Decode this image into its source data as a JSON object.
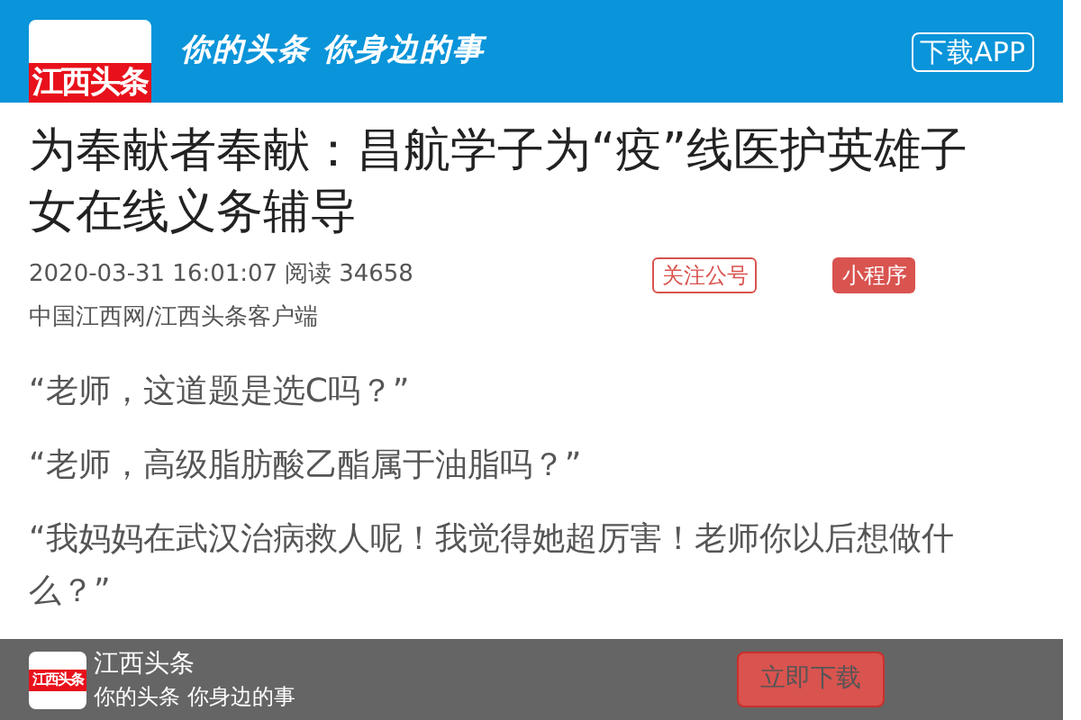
{
  "header": {
    "logo_text": "江西头条",
    "slogan": "你的头条 你身边的事",
    "download_button": "下载APP"
  },
  "article": {
    "title": "为奉献者奉献：昌航学子为“疫”线医护英雄子女在线义务辅导",
    "datetime": "2020-03-31 16:01:07",
    "read_label": "阅读",
    "read_count": "34658",
    "follow_button": "关注公号",
    "miniprogram_button": "小程序",
    "source": "中国江西网/江西头条客户端",
    "paragraphs": [
      "“老师，这道题是选C吗？”",
      "“老师，高级脂肪酸乙酯属于油脂吗？”",
      "“我妈妈在武汉治病救人呢！我觉得她超厉害！老师你以后想做什么？”"
    ]
  },
  "app_banner": {
    "logo_text": "江西头条",
    "name": "江西头条",
    "slogan": "你的头条 你身边的事",
    "download_button": "立即下载"
  }
}
